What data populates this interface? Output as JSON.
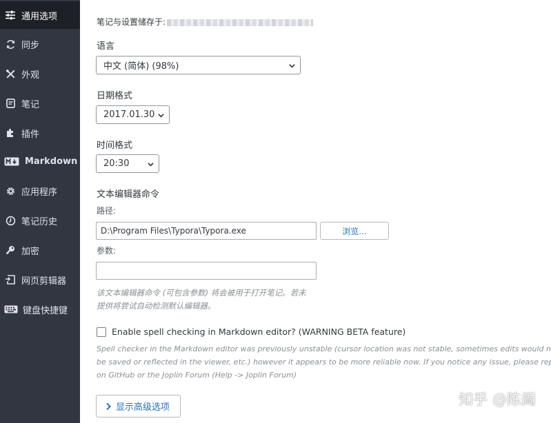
{
  "sidebar": {
    "items": [
      {
        "label": "通用选项",
        "icon": "sliders-icon",
        "active": true
      },
      {
        "label": "同步",
        "icon": "sync-icon"
      },
      {
        "label": "外观",
        "icon": "brush-icon"
      },
      {
        "label": "笔记",
        "icon": "note-icon"
      },
      {
        "label": "插件",
        "icon": "puzzle-icon"
      },
      {
        "label": "Markdown",
        "icon": "markdown-icon"
      },
      {
        "label": "应用程序",
        "icon": "gear-icon"
      },
      {
        "label": "笔记历史",
        "icon": "clock-icon"
      },
      {
        "label": "加密",
        "icon": "key-icon"
      },
      {
        "label": "网页剪辑器",
        "icon": "clipper-icon"
      },
      {
        "label": "键盘快捷键",
        "icon": "keyboard-icon"
      }
    ]
  },
  "general": {
    "storage_label": "笔记与设置储存于:",
    "language": {
      "label": "语言",
      "value": "中文 (简体) (98%)"
    },
    "date_format": {
      "label": "日期格式",
      "value": "2017.01.30"
    },
    "time_format": {
      "label": "时间格式",
      "value": "20:30"
    },
    "editor": {
      "title": "文本编辑器命令",
      "path_label": "路径:",
      "path_value": "D:\\Program Files\\Typora\\Typora.exe",
      "browse_label": "浏览...",
      "args_label": "参数:",
      "args_value": "",
      "description_line1": "该文本编辑器命令 (可包含参数) 将会被用于打开笔记。若未",
      "description_line2": "提供将尝试自动检测默认编辑器。"
    },
    "spellcheck": {
      "label": "Enable spell checking in Markdown editor? (WARNING BETA feature)",
      "checked": false,
      "desc_line1": "Spell checker in the Markdown editor was previously unstable (cursor location was not stable, sometimes edits would not",
      "desc_line2": "be saved or reflected in the viewer, etc.) however it appears to be more reliable now. If you notice any issue, please report it",
      "desc_line3": "on GitHub or the Joplin Forum (Help -> Joplin Forum)"
    },
    "advanced_button": "显示高级选项"
  },
  "watermark": "知乎 @陈阖",
  "colors": {
    "sidebar_bg": "#313640",
    "sidebar_active_bg": "#1d2026",
    "link_blue": "#2d6fb0"
  }
}
